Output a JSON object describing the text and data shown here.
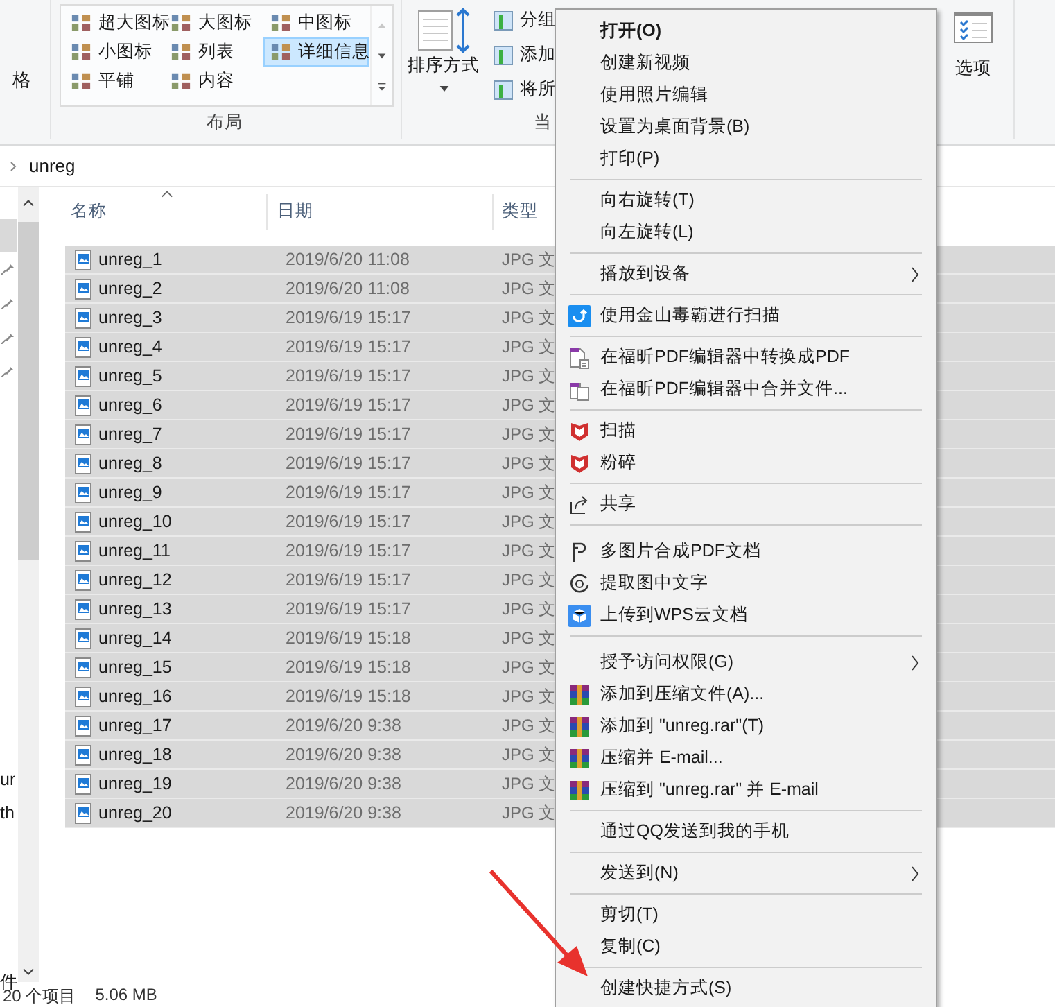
{
  "ribbon": {
    "cut_label": "格",
    "layout_options": [
      {
        "label": "超大图标",
        "selected": false
      },
      {
        "label": "大图标",
        "selected": false
      },
      {
        "label": "中图标",
        "selected": false
      },
      {
        "label": "小图标",
        "selected": false
      },
      {
        "label": "列表",
        "selected": false
      },
      {
        "label": "详细信息",
        "selected": true
      },
      {
        "label": "平铺",
        "selected": false
      },
      {
        "label": "内容",
        "selected": false
      }
    ],
    "layout_group_label": "布局",
    "sort_button": "排序方式",
    "view_buttons": [
      "分组",
      "添加",
      "将所"
    ],
    "view_group_label": "当",
    "options_button": "选项"
  },
  "address_bar": {
    "path": "unreg"
  },
  "nav_pane": {
    "items": [
      "ur",
      "th",
      "件"
    ]
  },
  "file_list": {
    "columns": [
      "名称",
      "日期",
      "类型"
    ],
    "rows": [
      {
        "name": "unreg_1",
        "date": "2019/6/20 11:08",
        "type": "JPG 文",
        "selected": true
      },
      {
        "name": "unreg_2",
        "date": "2019/6/20 11:08",
        "type": "JPG 文",
        "selected": true
      },
      {
        "name": "unreg_3",
        "date": "2019/6/19 15:17",
        "type": "JPG 文",
        "selected": true
      },
      {
        "name": "unreg_4",
        "date": "2019/6/19 15:17",
        "type": "JPG 文",
        "selected": true
      },
      {
        "name": "unreg_5",
        "date": "2019/6/19 15:17",
        "type": "JPG 文",
        "selected": true
      },
      {
        "name": "unreg_6",
        "date": "2019/6/19 15:17",
        "type": "JPG 文",
        "selected": true
      },
      {
        "name": "unreg_7",
        "date": "2019/6/19 15:17",
        "type": "JPG 文",
        "selected": true
      },
      {
        "name": "unreg_8",
        "date": "2019/6/19 15:17",
        "type": "JPG 文",
        "selected": true
      },
      {
        "name": "unreg_9",
        "date": "2019/6/19 15:17",
        "type": "JPG 文",
        "selected": true
      },
      {
        "name": "unreg_10",
        "date": "2019/6/19 15:17",
        "type": "JPG 文",
        "selected": true
      },
      {
        "name": "unreg_11",
        "date": "2019/6/19 15:17",
        "type": "JPG 文",
        "selected": true
      },
      {
        "name": "unreg_12",
        "date": "2019/6/19 15:17",
        "type": "JPG 文",
        "selected": true
      },
      {
        "name": "unreg_13",
        "date": "2019/6/19 15:17",
        "type": "JPG 文",
        "selected": true
      },
      {
        "name": "unreg_14",
        "date": "2019/6/19 15:18",
        "type": "JPG 文",
        "selected": true
      },
      {
        "name": "unreg_15",
        "date": "2019/6/19 15:18",
        "type": "JPG 文",
        "selected": true
      },
      {
        "name": "unreg_16",
        "date": "2019/6/19 15:18",
        "type": "JPG 文",
        "selected": true
      },
      {
        "name": "unreg_17",
        "date": "2019/6/20 9:38",
        "type": "JPG 文",
        "selected": true
      },
      {
        "name": "unreg_18",
        "date": "2019/6/20 9:38",
        "type": "JPG 文",
        "selected": true
      },
      {
        "name": "unreg_19",
        "date": "2019/6/20 9:38",
        "type": "JPG 文",
        "selected": true
      },
      {
        "name": "unreg_20",
        "date": "2019/6/20 9:38",
        "type": "JPG 文",
        "selected": true
      }
    ]
  },
  "status_bar": {
    "item_count": "20 个项目",
    "size": "5.06 MB"
  },
  "context_menu": {
    "items": [
      {
        "kind": "item",
        "label": "打开(O)",
        "bold": true
      },
      {
        "kind": "item",
        "label": "创建新视频"
      },
      {
        "kind": "item",
        "label": "使用照片编辑"
      },
      {
        "kind": "item",
        "label": "设置为桌面背景(B)"
      },
      {
        "kind": "item",
        "label": "打印(P)"
      },
      {
        "kind": "separator"
      },
      {
        "kind": "item",
        "label": "向右旋转(T)"
      },
      {
        "kind": "item",
        "label": "向左旋转(L)"
      },
      {
        "kind": "separator"
      },
      {
        "kind": "item",
        "label": "播放到设备",
        "submenu": true
      },
      {
        "kind": "separator"
      },
      {
        "kind": "item",
        "label": "使用金山毒霸进行扫描"
      },
      {
        "kind": "separator"
      },
      {
        "kind": "item",
        "label": "在福昕PDF编辑器中转换成PDF"
      },
      {
        "kind": "item",
        "label": "在福昕PDF编辑器中合并文件..."
      },
      {
        "kind": "separator"
      },
      {
        "kind": "item",
        "label": "扫描"
      },
      {
        "kind": "item",
        "label": "粉碎"
      },
      {
        "kind": "separator"
      },
      {
        "kind": "item",
        "label": "共享"
      },
      {
        "kind": "separator"
      },
      {
        "kind": "gap"
      },
      {
        "kind": "item",
        "label": "多图片合成PDF文档"
      },
      {
        "kind": "item",
        "label": "提取图中文字"
      },
      {
        "kind": "item",
        "label": "上传到WPS云文档"
      },
      {
        "kind": "separator"
      },
      {
        "kind": "gap"
      },
      {
        "kind": "item",
        "label": "授予访问权限(G)",
        "submenu": true
      },
      {
        "kind": "item",
        "label": "添加到压缩文件(A)..."
      },
      {
        "kind": "item",
        "label": "添加到 \"unreg.rar\"(T)"
      },
      {
        "kind": "item",
        "label": "压缩并 E-mail..."
      },
      {
        "kind": "item",
        "label": "压缩到 \"unreg.rar\" 并 E-mail"
      },
      {
        "kind": "separator"
      },
      {
        "kind": "item",
        "label": "通过QQ发送到我的手机"
      },
      {
        "kind": "separator"
      },
      {
        "kind": "item",
        "label": "发送到(N)",
        "submenu": true
      },
      {
        "kind": "separator"
      },
      {
        "kind": "item",
        "label": "剪切(T)"
      },
      {
        "kind": "item",
        "label": "复制(C)"
      },
      {
        "kind": "separator"
      },
      {
        "kind": "item",
        "label": "创建快捷方式(S)"
      }
    ]
  },
  "annotation_arrow": true
}
